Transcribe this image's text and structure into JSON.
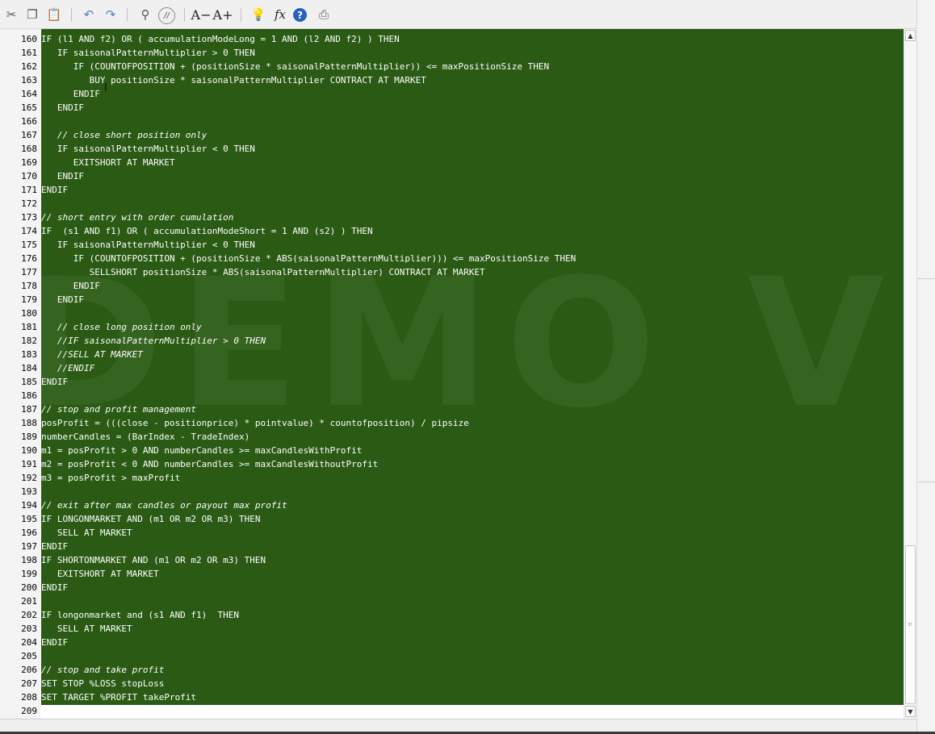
{
  "toolbar": {
    "buttons": [
      {
        "name": "cut-icon",
        "glyph": "✂"
      },
      {
        "name": "copy-icon",
        "glyph": "❐"
      },
      {
        "name": "paste-icon",
        "glyph": "📋"
      },
      {
        "name": "undo-icon",
        "glyph": "↶"
      },
      {
        "name": "redo-icon",
        "glyph": "↷"
      },
      {
        "name": "search-icon",
        "glyph": "⚲"
      },
      {
        "name": "comment-icon",
        "glyph": "//"
      },
      {
        "name": "decrease-font-icon",
        "glyph": "A−"
      },
      {
        "name": "increase-font-icon",
        "glyph": "A+"
      },
      {
        "name": "lightbulb-icon",
        "glyph": "💡"
      },
      {
        "name": "function-icon",
        "glyph": "fx"
      },
      {
        "name": "help-icon",
        "glyph": "?"
      },
      {
        "name": "print-icon",
        "glyph": "⎙"
      }
    ]
  },
  "editor": {
    "watermark": "DEMO VERS",
    "lines": [
      {
        "n": "160",
        "text": "IF (l1 AND f2) OR ( accumulationModeLong = 1 AND (l2 AND f2) ) THEN",
        "comment": false
      },
      {
        "n": "161",
        "text": "   IF saisonalPatternMultiplier > 0 THEN",
        "comment": false
      },
      {
        "n": "162",
        "text": "      IF (COUNTOFPOSITION + (positionSize * saisonalPatternMultiplier)) <= maxPositionSize THEN",
        "comment": false
      },
      {
        "n": "163",
        "text": "         BUY positionSize * saisonalPatternMultiplier CONTRACT AT MARKET",
        "comment": false
      },
      {
        "n": "164",
        "text": "      ENDIF",
        "comment": false
      },
      {
        "n": "165",
        "text": "   ENDIF",
        "comment": false
      },
      {
        "n": "166",
        "text": "",
        "comment": false
      },
      {
        "n": "167",
        "text": "   // close short position only",
        "comment": true
      },
      {
        "n": "168",
        "text": "   IF saisonalPatternMultiplier < 0 THEN",
        "comment": false
      },
      {
        "n": "169",
        "text": "      EXITSHORT AT MARKET",
        "comment": false
      },
      {
        "n": "170",
        "text": "   ENDIF",
        "comment": false
      },
      {
        "n": "171",
        "text": "ENDIF",
        "comment": false
      },
      {
        "n": "172",
        "text": "",
        "comment": false
      },
      {
        "n": "173",
        "text": "// short entry with order cumulation",
        "comment": true
      },
      {
        "n": "174",
        "text": "IF  (s1 AND f1) OR ( accumulationModeShort = 1 AND (s2) ) THEN",
        "comment": false
      },
      {
        "n": "175",
        "text": "   IF saisonalPatternMultiplier < 0 THEN",
        "comment": false
      },
      {
        "n": "176",
        "text": "      IF (COUNTOFPOSITION + (positionSize * ABS(saisonalPatternMultiplier))) <= maxPositionSize THEN",
        "comment": false
      },
      {
        "n": "177",
        "text": "         SELLSHORT positionSize * ABS(saisonalPatternMultiplier) CONTRACT AT MARKET",
        "comment": false
      },
      {
        "n": "178",
        "text": "      ENDIF",
        "comment": false
      },
      {
        "n": "179",
        "text": "   ENDIF",
        "comment": false
      },
      {
        "n": "180",
        "text": "",
        "comment": false
      },
      {
        "n": "181",
        "text": "   // close long position only",
        "comment": true
      },
      {
        "n": "182",
        "text": "   //IF saisonalPatternMultiplier > 0 THEN",
        "comment": true
      },
      {
        "n": "183",
        "text": "   //SELL AT MARKET",
        "comment": true
      },
      {
        "n": "184",
        "text": "   //ENDIF",
        "comment": true
      },
      {
        "n": "185",
        "text": "ENDIF",
        "comment": false
      },
      {
        "n": "186",
        "text": "",
        "comment": false
      },
      {
        "n": "187",
        "text": "// stop and profit management",
        "comment": true
      },
      {
        "n": "188",
        "text": "posProfit = (((close - positionprice) * pointvalue) * countofposition) / pipsize",
        "comment": false
      },
      {
        "n": "189",
        "text": "numberCandles = (BarIndex - TradeIndex)",
        "comment": false
      },
      {
        "n": "190",
        "text": "m1 = posProfit > 0 AND numberCandles >= maxCandlesWithProfit",
        "comment": false
      },
      {
        "n": "191",
        "text": "m2 = posProfit < 0 AND numberCandles >= maxCandlesWithoutProfit",
        "comment": false
      },
      {
        "n": "192",
        "text": "m3 = posProfit > maxProfit",
        "comment": false
      },
      {
        "n": "193",
        "text": "",
        "comment": false
      },
      {
        "n": "194",
        "text": "// exit after max candles or payout max profit",
        "comment": true
      },
      {
        "n": "195",
        "text": "IF LONGONMARKET AND (m1 OR m2 OR m3) THEN",
        "comment": false
      },
      {
        "n": "196",
        "text": "   SELL AT MARKET",
        "comment": false
      },
      {
        "n": "197",
        "text": "ENDIF",
        "comment": false
      },
      {
        "n": "198",
        "text": "IF SHORTONMARKET AND (m1 OR m2 OR m3) THEN",
        "comment": false
      },
      {
        "n": "199",
        "text": "   EXITSHORT AT MARKET",
        "comment": false
      },
      {
        "n": "200",
        "text": "ENDIF",
        "comment": false
      },
      {
        "n": "201",
        "text": "",
        "comment": false
      },
      {
        "n": "202",
        "text": "IF longonmarket and (s1 AND f1)  THEN",
        "comment": false
      },
      {
        "n": "203",
        "text": "   SELL AT MARKET",
        "comment": false
      },
      {
        "n": "204",
        "text": "ENDIF",
        "comment": false
      },
      {
        "n": "205",
        "text": "",
        "comment": false
      },
      {
        "n": "206",
        "text": "// stop and take profit",
        "comment": true
      },
      {
        "n": "207",
        "text": "SET STOP %LOSS stopLoss",
        "comment": false
      },
      {
        "n": "208",
        "text": "SET TARGET %PROFIT takeProfit",
        "comment": false
      },
      {
        "n": "209",
        "text": "",
        "comment": false
      }
    ]
  },
  "scrollbar": {
    "up": "▲",
    "down": "▼",
    "grip": "≡"
  },
  "colors": {
    "selection": "#2a5a14",
    "gutter": "#f4f4f4",
    "toolbar": "#f0f0f0"
  }
}
